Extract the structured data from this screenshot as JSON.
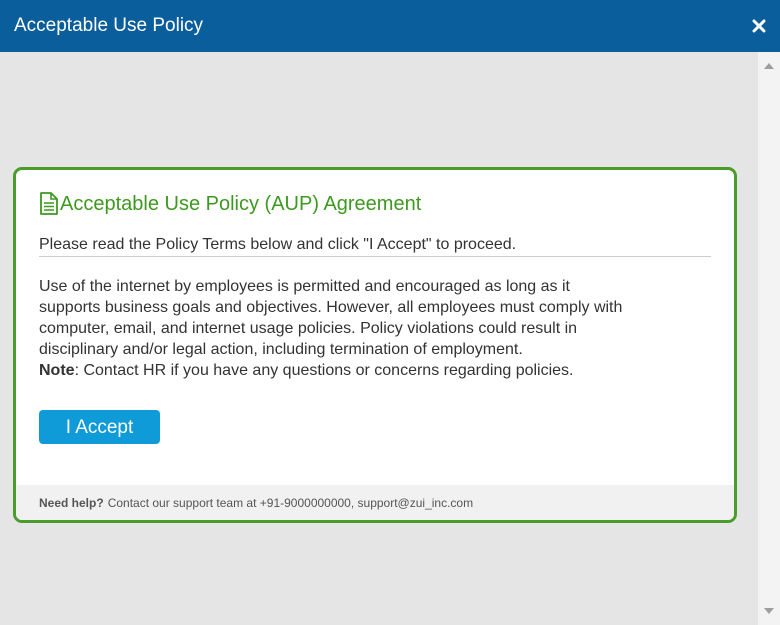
{
  "window": {
    "title": "Acceptable Use Policy",
    "header_color": "#0a5e9c"
  },
  "card": {
    "heading": "Acceptable Use Policy (AUP) Agreement",
    "heading_icon": "document-icon",
    "accent_color": "#4a9d2b",
    "instruction": "Please read the Policy Terms below and click \"I Accept\" to proceed.",
    "policy_lines": [
      "Use of the internet by employees is permitted and encouraged as long as it",
      "supports business goals and objectives. However, all employees must comply with",
      "computer, email, and internet usage policies. Policy violations could result in",
      "disciplinary and/or legal action, including termination of employment."
    ],
    "note_label": "Note",
    "note_text": ": Contact HR if you have any questions or concerns regarding policies.",
    "accept_button_label": "I Accept",
    "button_color": "#0f9bd7"
  },
  "footer": {
    "help_label": "Need help?",
    "help_text": "Contact our support team at +91-9000000000, support@zui_inc.com"
  }
}
